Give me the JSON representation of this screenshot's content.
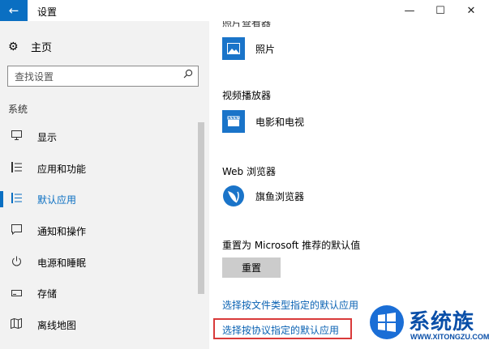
{
  "window": {
    "title": "设置",
    "back_glyph": "←",
    "min_glyph": "—",
    "max_glyph": "☐",
    "close_glyph": "✕"
  },
  "sidebar": {
    "home_label": "主页",
    "search_placeholder": "查找设置",
    "section_label": "系统",
    "items": [
      {
        "label": "显示",
        "icon": "monitor-icon"
      },
      {
        "label": "应用和功能",
        "icon": "list-icon"
      },
      {
        "label": "默认应用",
        "icon": "default-apps-icon",
        "selected": true
      },
      {
        "label": "通知和操作",
        "icon": "notification-icon"
      },
      {
        "label": "电源和睡眠",
        "icon": "power-icon"
      },
      {
        "label": "存储",
        "icon": "storage-icon"
      },
      {
        "label": "离线地图",
        "icon": "map-icon"
      }
    ]
  },
  "main": {
    "cut_label": "照片查看器",
    "photo_app": "照片",
    "video_label": "视频播放器",
    "video_app": "电影和电视",
    "web_label": "Web 浏览器",
    "web_app": "旗鱼浏览器",
    "reset_label": "重置为 Microsoft 推荐的默认值",
    "reset_button": "重置",
    "link_file_type": "选择按文件类型指定的默认应用",
    "link_protocol": "选择按协议指定的默认应用"
  },
  "watermark": {
    "text": "系统族",
    "url": "WWW.XITONGZU.COM"
  },
  "colors": {
    "accent": "#0a6fc2",
    "highlight_box": "#d93a3a",
    "sidebar_bg": "#f2f2f2"
  }
}
